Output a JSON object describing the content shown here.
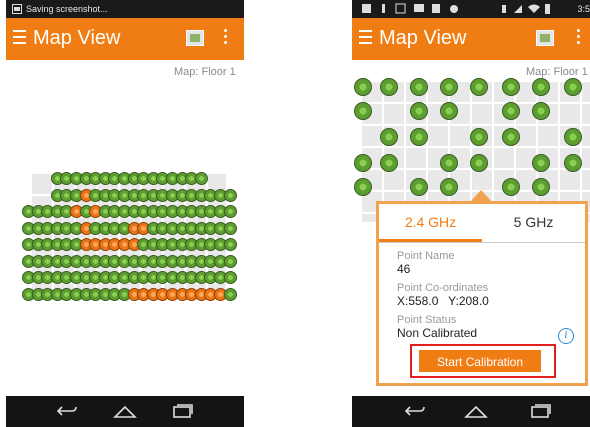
{
  "left_phone": {
    "status_text": "Saving screenshot...",
    "title": "Map View",
    "map_label": "Map: Floor 1"
  },
  "right_phone": {
    "status_time": "3:5",
    "title": "Map View",
    "map_label": "Map: Floor 1"
  },
  "popup": {
    "tabs": [
      {
        "label": "2.4 GHz",
        "active": true
      },
      {
        "label": "5 GHz",
        "active": false
      }
    ],
    "fields": [
      {
        "label": "Point Name",
        "value": "46"
      },
      {
        "label": "Point Co-ordinates",
        "value": "X:558.0   Y:208.0"
      },
      {
        "label": "Point Status",
        "value": "Non Calibrated"
      }
    ],
    "action_label": "Start Calibration"
  },
  "colors": {
    "accent": "#f07d13",
    "calibrated": "#5d9e31",
    "uncalibrated": "#ea7416",
    "highlight": "#e02020"
  }
}
